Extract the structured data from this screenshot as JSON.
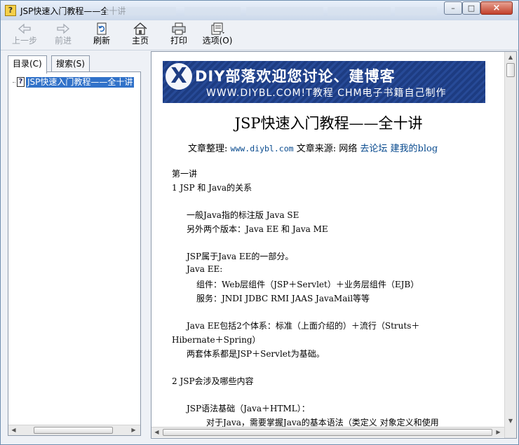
{
  "window": {
    "title": "JSP快速入门教程——全十讲",
    "controls": {
      "minimize": "–",
      "maximize": "□",
      "close": "×"
    }
  },
  "toolbar": {
    "buttons": [
      {
        "label": "上一步",
        "icon": "back-arrow-icon",
        "enabled": false
      },
      {
        "label": "前进",
        "icon": "forward-arrow-icon",
        "enabled": false
      },
      {
        "label": "刷新",
        "icon": "refresh-icon",
        "enabled": true
      },
      {
        "label": "主页",
        "icon": "home-icon",
        "enabled": true
      },
      {
        "label": "打印",
        "icon": "print-icon",
        "enabled": true
      },
      {
        "label": "选项(O)",
        "icon": "options-icon",
        "enabled": true
      }
    ]
  },
  "nav": {
    "tabs": [
      {
        "label": "目录(C)"
      },
      {
        "label": "搜索(S)"
      }
    ],
    "active_tab": 0,
    "tree": [
      {
        "label": "JSP快速入门教程——全十讲",
        "selected": true
      }
    ]
  },
  "banner": {
    "title": "DIY部落欢迎您讨论、建博客",
    "subtitle": "WWW.DIYBL.COM!T教程 CHM电子书籍自己制作"
  },
  "article": {
    "title": "JSP快速入门教程——全十讲",
    "byline": {
      "editor_label": "文章整理:",
      "editor_site": "www.diybl.com",
      "source_label": "文章来源:",
      "source": "网络",
      "link1": "去论坛",
      "link2": "建我的blog"
    },
    "lines": [
      "第一讲",
      "1 JSP 和 Java的关系",
      "一般Java指的标注版 Java SE",
      "另外两个版本：Java EE 和 Java ME",
      "JSP属于Java EE的一部分。",
      "Java EE:",
      "组件：Web层组件（JSP＋Servlet）＋业务层组件（EJB）",
      "服务：JNDI JDBC RMI JAAS JavaMail等等",
      "Java EE包括2个体系：标准（上面介绍的）＋流行（Struts＋",
      "Hibernate＋Spring）",
      "两套体系都是JSP＋Servlet为基础。",
      "2 JSP会涉及哪些内容",
      "JSP语法基础（Java＋HTML）：",
      "对于Java，需要掌握Java的基本语法（类定义 对象定义和使用"
    ]
  },
  "colors": {
    "selection": "#3172c9",
    "link": "#084a8e",
    "banner": "#1d3c82"
  }
}
